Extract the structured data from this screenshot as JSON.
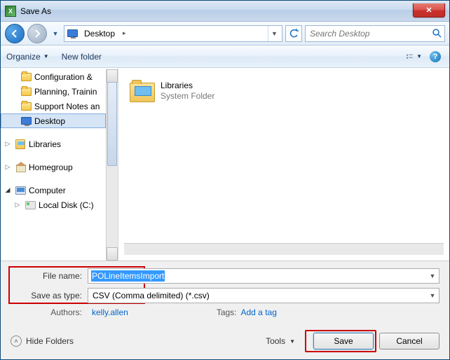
{
  "titlebar": {
    "title": "Save As",
    "close_symbol": "✕"
  },
  "nav": {
    "back_symbol": "◄",
    "forward_symbol": "►",
    "dropdown_symbol": "▼",
    "breadcrumb_location": "Desktop",
    "breadcrumb_chevron": "▸",
    "refresh_symbol": "↻",
    "search_placeholder": "Search Desktop",
    "search_icon": "🔍"
  },
  "toolbar": {
    "organize_label": "Organize",
    "newfolder_label": "New folder",
    "dropdown_symbol": "▼",
    "help_symbol": "?"
  },
  "tree": {
    "items": [
      {
        "label": "Configuration &",
        "icon": "folder",
        "indent": 2
      },
      {
        "label": "Planning, Trainin",
        "icon": "folder",
        "indent": 2
      },
      {
        "label": "Support Notes an",
        "icon": "folder",
        "indent": 2
      },
      {
        "label": "Desktop",
        "icon": "desktop",
        "indent": 2,
        "selected": true
      }
    ],
    "libraries": {
      "label": "Libraries",
      "twisty": "▷"
    },
    "homegroup": {
      "label": "Homegroup",
      "twisty": "▷"
    },
    "computer": {
      "label": "Computer",
      "twisty": "◢"
    },
    "localdisk": {
      "label": "Local Disk (C:)",
      "twisty": "▷"
    }
  },
  "content": {
    "item_title": "Libraries",
    "item_subtitle": "System Folder"
  },
  "form": {
    "filename_label": "File name:",
    "filename_value": "POLineItemsImport",
    "filetype_label": "Save as type:",
    "filetype_value": "CSV (Comma delimited) (*.csv)",
    "authors_label": "Authors:",
    "authors_value": "kelly.allen",
    "tags_label": "Tags:",
    "tags_value": "Add a tag"
  },
  "actions": {
    "hide_folders_label": "Hide Folders",
    "hide_folders_symbol": "˄",
    "tools_label": "Tools",
    "tools_symbol": "▼",
    "save_label": "Save",
    "cancel_label": "Cancel"
  }
}
